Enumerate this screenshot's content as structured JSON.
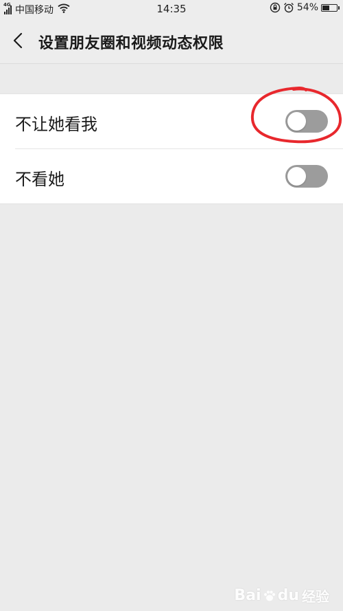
{
  "status_bar": {
    "network": "4G",
    "carrier": "中国移动",
    "time": "14:35",
    "battery_percent": "54%",
    "battery_level": 0.54
  },
  "nav": {
    "title": "设置朋友圈和视频动态权限"
  },
  "settings": [
    {
      "label": "不让她看我",
      "enabled": false
    },
    {
      "label": "不看她",
      "enabled": false
    }
  ],
  "annotation": {
    "color": "#e8282d"
  },
  "watermark": {
    "brand": "Bai",
    "brand_suffix": "du",
    "sub": "经验"
  },
  "colors": {
    "toggle_off": "#9c9c9c",
    "background": "#ebebeb"
  }
}
